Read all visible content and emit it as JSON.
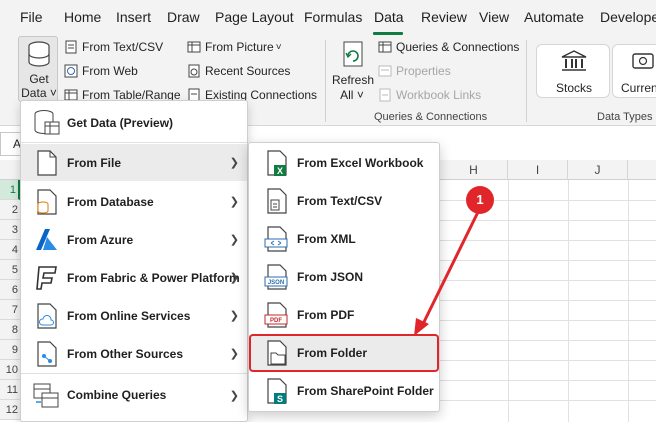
{
  "menubar": {
    "tabs": [
      {
        "label": "File"
      },
      {
        "label": "Home"
      },
      {
        "label": "Insert"
      },
      {
        "label": "Draw"
      },
      {
        "label": "Page Layout"
      },
      {
        "label": "Formulas"
      },
      {
        "label": "Data"
      },
      {
        "label": "Review"
      },
      {
        "label": "View"
      },
      {
        "label": "Automate"
      },
      {
        "label": "Developer"
      }
    ],
    "active_tab": "Data",
    "accent": "#107c41"
  },
  "ribbon": {
    "get_data": {
      "line1": "Get",
      "line2": "Data",
      "chevron": "˅"
    },
    "import": {
      "from_text_csv": "From Text/CSV",
      "from_web": "From Web",
      "from_table_range": "From Table/Range",
      "from_picture": "From Picture",
      "recent_sources": "Recent Sources",
      "existing_connections": "Existing Connections"
    },
    "refresh": {
      "line1": "Refresh",
      "line2": "All",
      "chevron": "˅"
    },
    "queries": {
      "queries_connections": "Queries & Connections",
      "properties": "Properties",
      "workbook_links": "Workbook Links",
      "group_label": "Queries & Connections"
    },
    "data_types": {
      "stocks": "Stocks",
      "currencies": "Currencies",
      "group_label": "Data Types"
    }
  },
  "grid": {
    "name_box_value": "A",
    "columns": [
      "H",
      "I",
      "J"
    ],
    "rows": [
      "1",
      "2",
      "3",
      "4",
      "5",
      "6",
      "7",
      "8",
      "9",
      "10",
      "11",
      "12"
    ]
  },
  "get_data_menu": {
    "items": [
      {
        "label": "Get Data (Preview)",
        "icon": "table-icon",
        "submenu": false
      },
      {
        "label": "From File",
        "icon": "file-icon",
        "submenu": true
      },
      {
        "label": "From Database",
        "icon": "database-icon",
        "submenu": true
      },
      {
        "label": "From Azure",
        "icon": "azure-icon",
        "submenu": true
      },
      {
        "label": "From Fabric & Power Platform",
        "icon": "fabric-icon",
        "submenu": true
      },
      {
        "label": "From Online Services",
        "icon": "cloud-file-icon",
        "submenu": true
      },
      {
        "label": "From Other Sources",
        "icon": "network-file-icon",
        "submenu": true
      },
      {
        "label": "Combine Queries",
        "icon": "combine-icon",
        "submenu": true
      }
    ]
  },
  "from_file_menu": {
    "items": [
      {
        "label": "From Excel Workbook",
        "icon": "excel-file-icon"
      },
      {
        "label": "From Text/CSV",
        "icon": "text-file-icon"
      },
      {
        "label": "From XML",
        "icon": "xml-file-icon"
      },
      {
        "label": "From JSON",
        "icon": "json-file-icon"
      },
      {
        "label": "From PDF",
        "icon": "pdf-file-icon"
      },
      {
        "label": "From Folder",
        "icon": "folder-file-icon"
      },
      {
        "label": "From SharePoint Folder",
        "icon": "sharepoint-file-icon"
      }
    ]
  },
  "callout": {
    "number": "1",
    "color": "#e0262b"
  }
}
